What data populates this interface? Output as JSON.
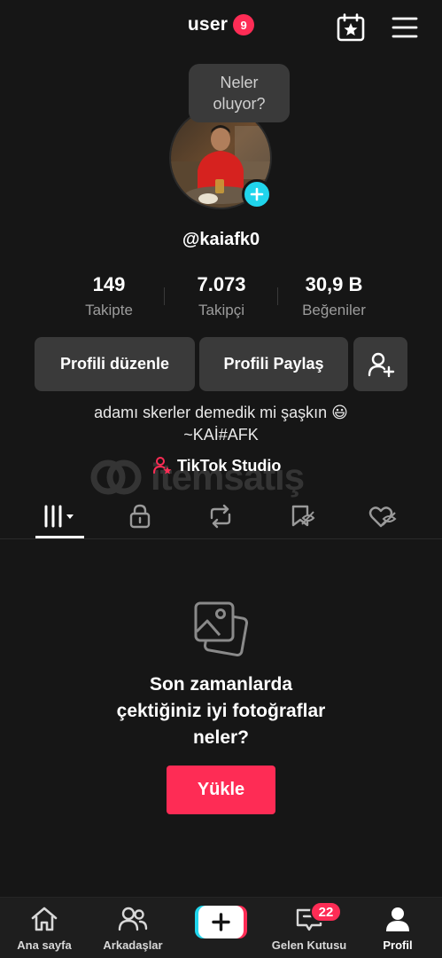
{
  "header": {
    "username": "user",
    "notification_count": "9",
    "calendar_icon": "calendar-star-icon",
    "menu_icon": "menu-icon"
  },
  "profile": {
    "bubble_line1": "Neler",
    "bubble_line2": "oluyor?",
    "handle": "@kaiafk0",
    "stats": [
      {
        "value": "149",
        "label": "Takipte"
      },
      {
        "value": "7.073",
        "label": "Takipçi"
      },
      {
        "value": "30,9 B",
        "label": "Beğeniler"
      }
    ],
    "edit_label": "Profili düzenle",
    "share_label": "Profili Paylaş",
    "bio_line1": "adamı skerler demedik mi şaşkın 😃",
    "bio_line2": "~KAİ#AFK",
    "studio_label": "TikTok Studio"
  },
  "watermark": "itemsatış",
  "empty_state": {
    "line1": "Son zamanlarda",
    "line2": "çektiğiniz iyi fotoğraflar",
    "line3": "neler?",
    "upload_label": "Yükle"
  },
  "nav": {
    "home": "Ana sayfa",
    "friends": "Arkadaşlar",
    "inbox": "Gelen Kutusu",
    "inbox_count": "22",
    "profile": "Profil"
  },
  "colors": {
    "accent": "#fe2c55",
    "cyan": "#20d5ec",
    "background": "#161616"
  }
}
